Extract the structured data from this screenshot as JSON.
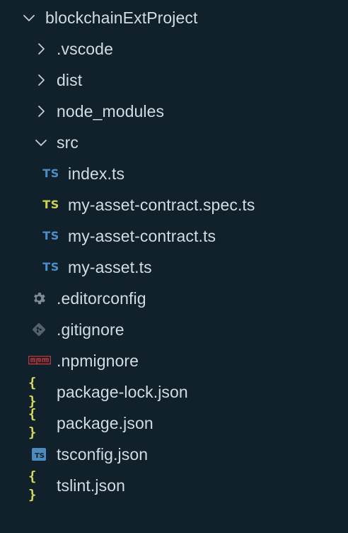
{
  "explorer": {
    "root": {
      "label": "blockchainExtProject",
      "expanded": true
    },
    "items": [
      {
        "label": ".vscode",
        "kind": "folder",
        "expanded": false
      },
      {
        "label": "dist",
        "kind": "folder",
        "expanded": false
      },
      {
        "label": "node_modules",
        "kind": "folder",
        "expanded": false
      },
      {
        "label": "src",
        "kind": "folder",
        "expanded": true
      },
      {
        "label": "index.ts",
        "kind": "ts-file",
        "icon_text": "TS"
      },
      {
        "label": "my-asset-contract.spec.ts",
        "kind": "ts-spec-file",
        "icon_text": "TS"
      },
      {
        "label": "my-asset-contract.ts",
        "kind": "ts-file",
        "icon_text": "TS"
      },
      {
        "label": "my-asset.ts",
        "kind": "ts-file",
        "icon_text": "TS"
      },
      {
        "label": ".editorconfig",
        "kind": "config-file",
        "icon": "gear-icon"
      },
      {
        "label": ".gitignore",
        "kind": "git-file",
        "icon": "git-icon"
      },
      {
        "label": ".npmignore",
        "kind": "npm-file",
        "icon": "npm-icon",
        "icon_text": "npm"
      },
      {
        "label": "package-lock.json",
        "kind": "json-file",
        "icon_text": "{ }"
      },
      {
        "label": "package.json",
        "kind": "json-file",
        "icon_text": "{ }"
      },
      {
        "label": "tsconfig.json",
        "kind": "tsconfig-file",
        "icon": "typescript-config-icon",
        "icon_text": "TS"
      },
      {
        "label": "tslint.json",
        "kind": "json-file",
        "icon_text": "{ }"
      }
    ]
  },
  "colors": {
    "background": "#10212b",
    "text": "#d2dce3",
    "chevron": "#c5ced6",
    "ts_blue": "#4a8fc9",
    "ts_yellow": "#cfd34c",
    "json_yellow": "#d6d95c",
    "gear_gray": "#7d8a94",
    "git_gray": "#56636d",
    "npm_red": "#b8333a",
    "tsconfig_box": "#4d8bbf"
  }
}
